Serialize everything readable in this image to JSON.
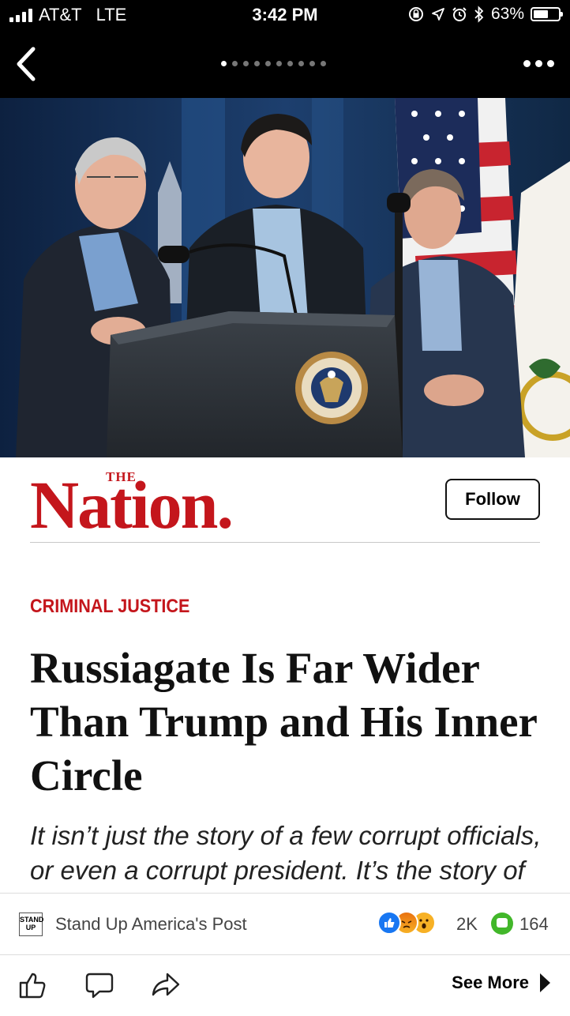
{
  "status_bar": {
    "carrier": "AT&T",
    "network": "LTE",
    "time": "3:42 PM",
    "battery": "63%",
    "battery_level": 0.63
  },
  "nav": {
    "page_count": 10,
    "active_page": 1
  },
  "hero": {
    "seal_text": "SEAL OF THE PRESIDENT OF THE UNITED STATES"
  },
  "publisher": {
    "logo_small": "THE",
    "logo_main": "Nation.",
    "follow_label": "Follow"
  },
  "article": {
    "category": "CRIMINAL JUSTICE",
    "headline": "Russiagate Is Far Wider Than Trump and His Inner Circle",
    "subheadline": "It isn’t just the story of a few corrupt officials, or even a corrupt president. It’s the story of a corrupt Republican Party."
  },
  "post": {
    "page_avatar_text": "STAND UP",
    "page_name": "Stand Up America's Post",
    "reaction_count": "2K",
    "comment_count": "164"
  },
  "actions": {
    "see_more_label": "See More"
  },
  "colors": {
    "brand_red": "#c4161c",
    "facebook_blue": "#1877f2",
    "comment_green": "#42b72a"
  },
  "icons": [
    "signal-icon",
    "rotation-lock-icon",
    "location-icon",
    "alarm-icon",
    "bluetooth-icon",
    "battery-icon",
    "back-chevron-icon",
    "more-dots-icon",
    "like-icon",
    "comment-icon",
    "share-icon",
    "play-arrow-icon"
  ]
}
